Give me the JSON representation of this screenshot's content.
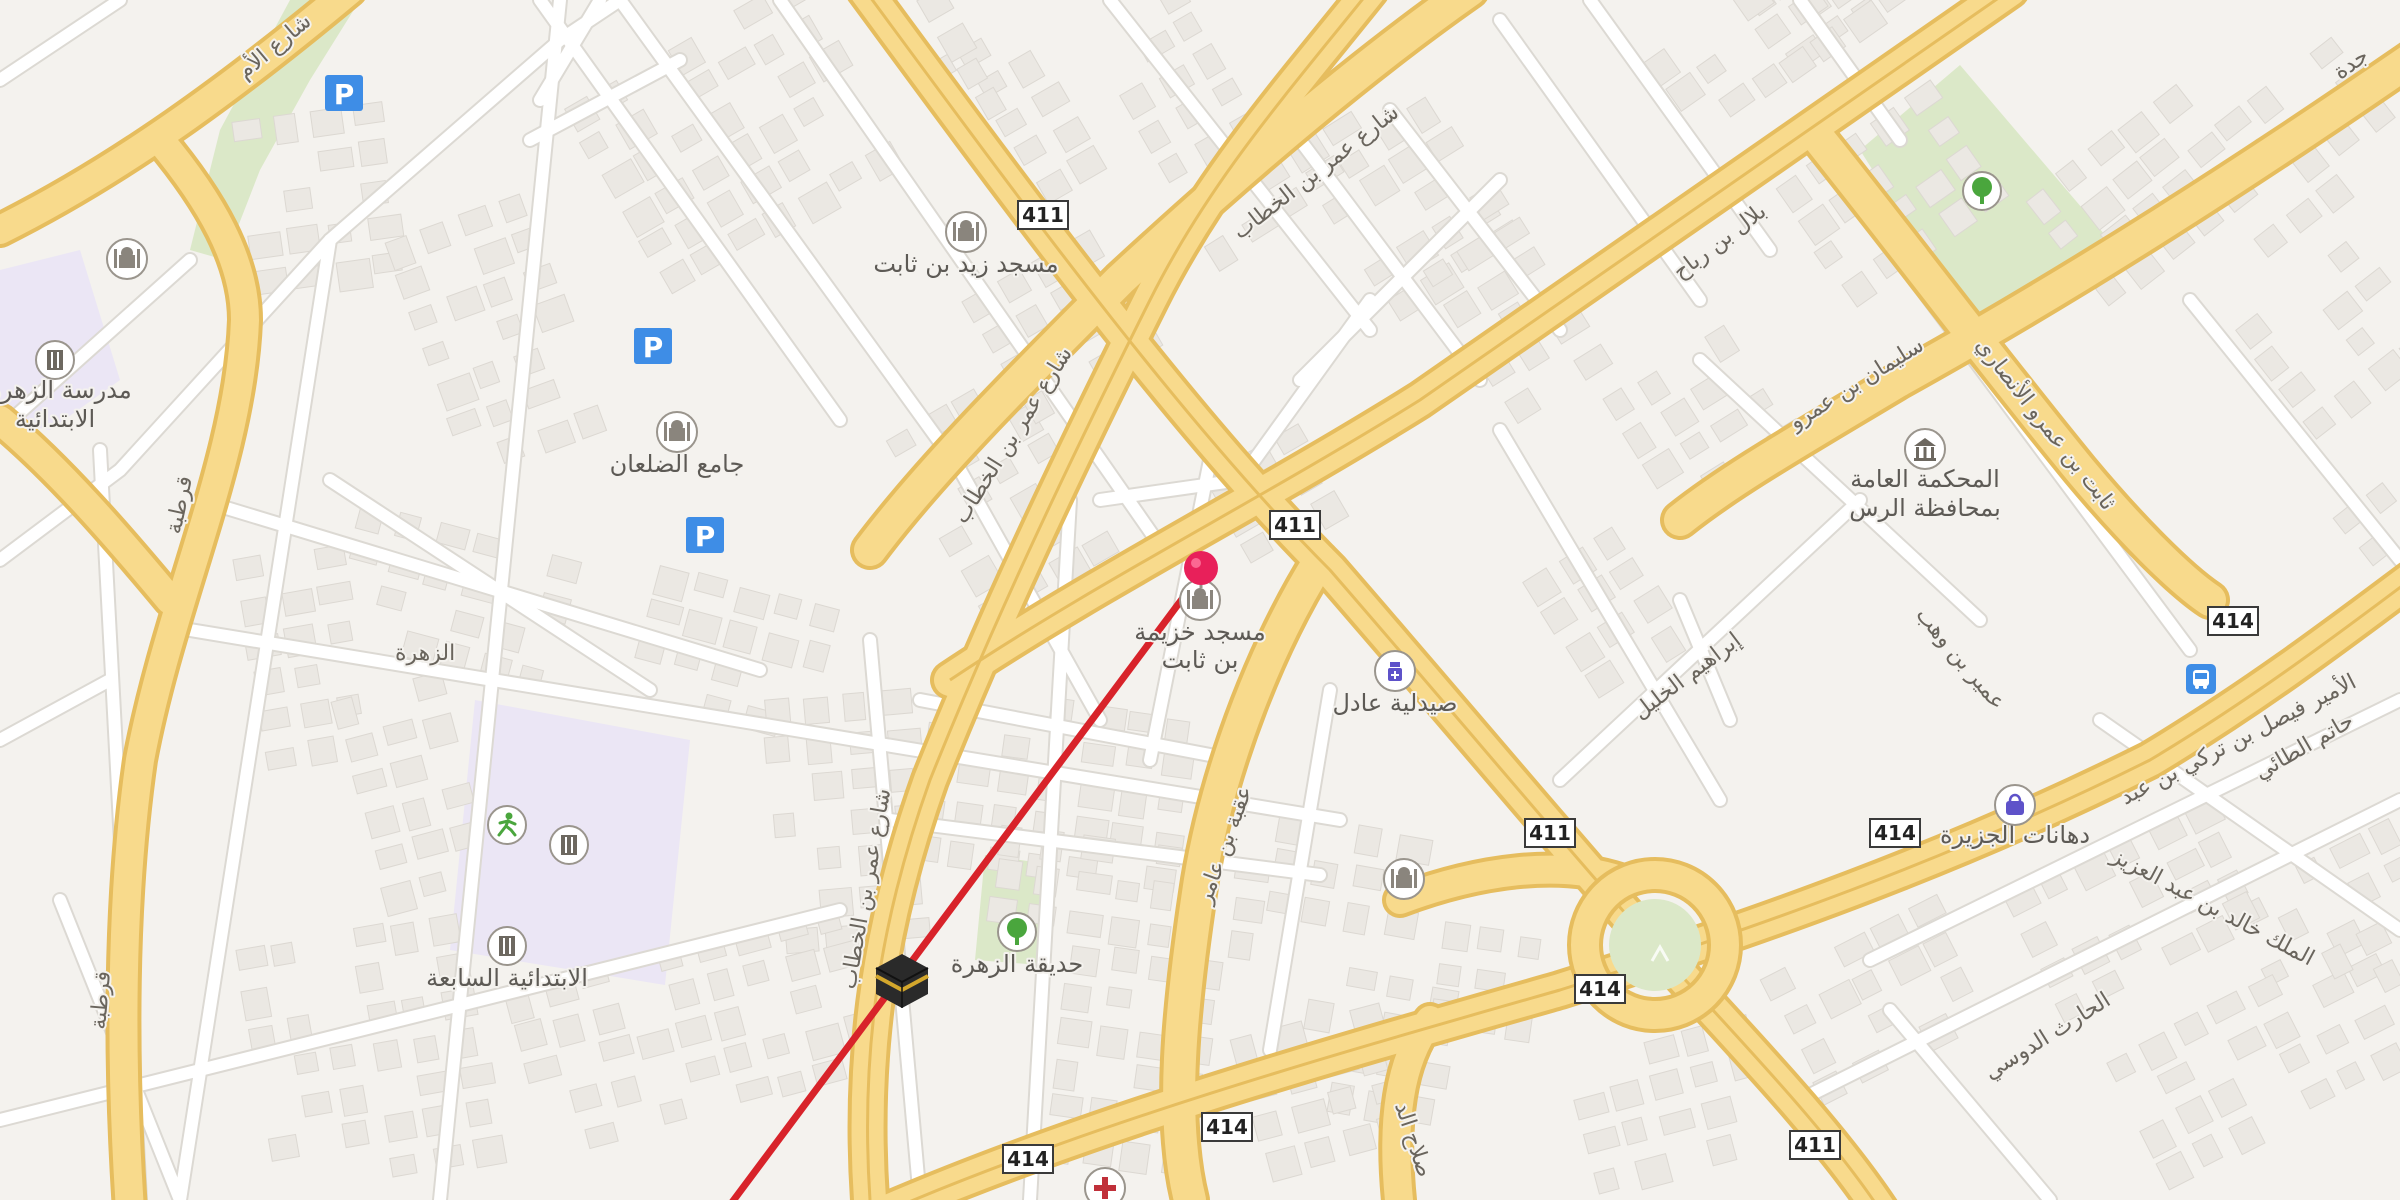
{
  "map": {
    "route_shields": [
      {
        "id": "s411a",
        "label": "411"
      },
      {
        "id": "s411b",
        "label": "411"
      },
      {
        "id": "s411c",
        "label": "411"
      },
      {
        "id": "s411d",
        "label": "411"
      },
      {
        "id": "s414a",
        "label": "414"
      },
      {
        "id": "s414b",
        "label": "414"
      },
      {
        "id": "s414c",
        "label": "414"
      },
      {
        "id": "s414d",
        "label": "414"
      },
      {
        "id": "s414e",
        "label": "414"
      }
    ],
    "places": {
      "mosque_zaid": "مسجد زيد بن ثابت",
      "mosque_dalaan": "جامع الضلعان",
      "mosque_khuzaima_1": "مسجد خزيمة",
      "mosque_khuzaima_2": "بن ثابت",
      "pharmacy": "صيدلية عادل",
      "court_1": "المحكمة العامة",
      "court_2": "بمحافظة الرس",
      "school_zahra_1": "مدرسة الزهرة",
      "school_zahra_2": "الابتدائية",
      "school_sabea": "الابتدائية السابعة",
      "garden_zahra": "حديقة الزهرة",
      "district_zahra": "الزهرة",
      "shop_jazeera": "دهانات الجزيرة"
    },
    "streets": {
      "umar_1": "شارع عمر بن الخطاب",
      "umar_2": "شارع عمر بن الخطاب",
      "umar_3": "شارع عمر بن الخطاب",
      "bilal": "بلال بن رباح",
      "sulaiman": "سليمان بن عمرو",
      "thabit": "ثابت بن عمرو الأنصاري",
      "ibrahim": "إبراهيم الخليل",
      "umair": "عمير بن وهب",
      "uqba": "عقبة بن عامر",
      "faisal": "الأمير فيصل بن تركي بن عبد",
      "khalid": "الملك خالد بن عبد العزيز",
      "harith": "الحارث الدوسي",
      "qurtuba_1": "قرطبة",
      "qurtuba_2": "قرطبة",
      "top_left": "شارع الأم",
      "top_right": "جدة",
      "salah": "صلاح الد",
      "hatimi": "حاتم الطائي"
    },
    "icons": [
      "parking-icon",
      "mosque-icon",
      "school-icon",
      "tree-icon",
      "pharmacy-icon",
      "court-icon",
      "shopping-bag-icon",
      "bus-icon",
      "sport-icon",
      "kaaba-icon",
      "hospital-icon",
      "pin-icon"
    ],
    "colors": {
      "background": "#f4f2ee",
      "major_road": "#f5d582",
      "major_road_casing": "#e3b654",
      "minor_road": "#ffffff",
      "park": "#dbe8c8",
      "school_area": "#ebe6f5",
      "route": "#d8232a",
      "pin": "#e8205a",
      "parking": "#3e8de6"
    }
  }
}
